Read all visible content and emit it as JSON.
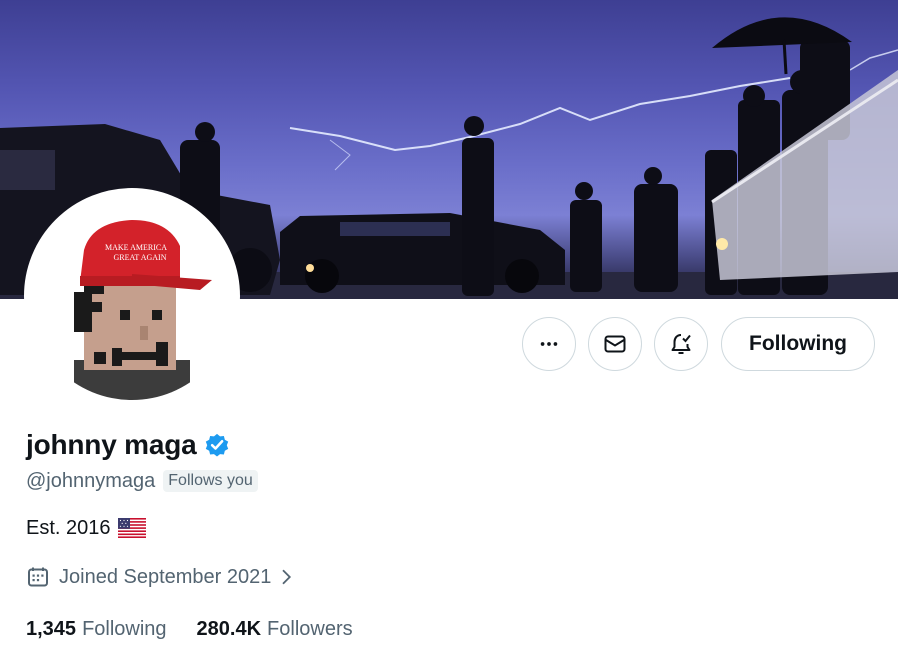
{
  "profile": {
    "display_name": "johnny maga",
    "handle": "@johnnymaga",
    "follows_you": "Follows you",
    "bio": "Est. 2016",
    "bio_flag": "us-flag-emoji",
    "joined": "Joined September 2021",
    "following_count": "1,345",
    "following_label": "Following",
    "followers_count": "280.4K",
    "followers_label": "Followers",
    "avatar_hat_text": "MAKE AMERICA GREAT AGAIN"
  },
  "actions": {
    "follow_button_label": "Following",
    "more_icon": "more-horizontal-icon",
    "message_icon": "envelope-icon",
    "notify_icon": "bell-check-icon"
  },
  "icons": {
    "verified": "verified-badge-icon",
    "calendar": "calendar-icon",
    "chevron": "chevron-right-icon"
  },
  "colors": {
    "verified_blue": "#1d9bf0",
    "text_primary": "#0f1419",
    "text_secondary": "#536471",
    "border": "#cfd9de",
    "tag_bg": "#eff3f4",
    "hat_red": "#d3222a",
    "banner_sky": "#5456b3"
  }
}
